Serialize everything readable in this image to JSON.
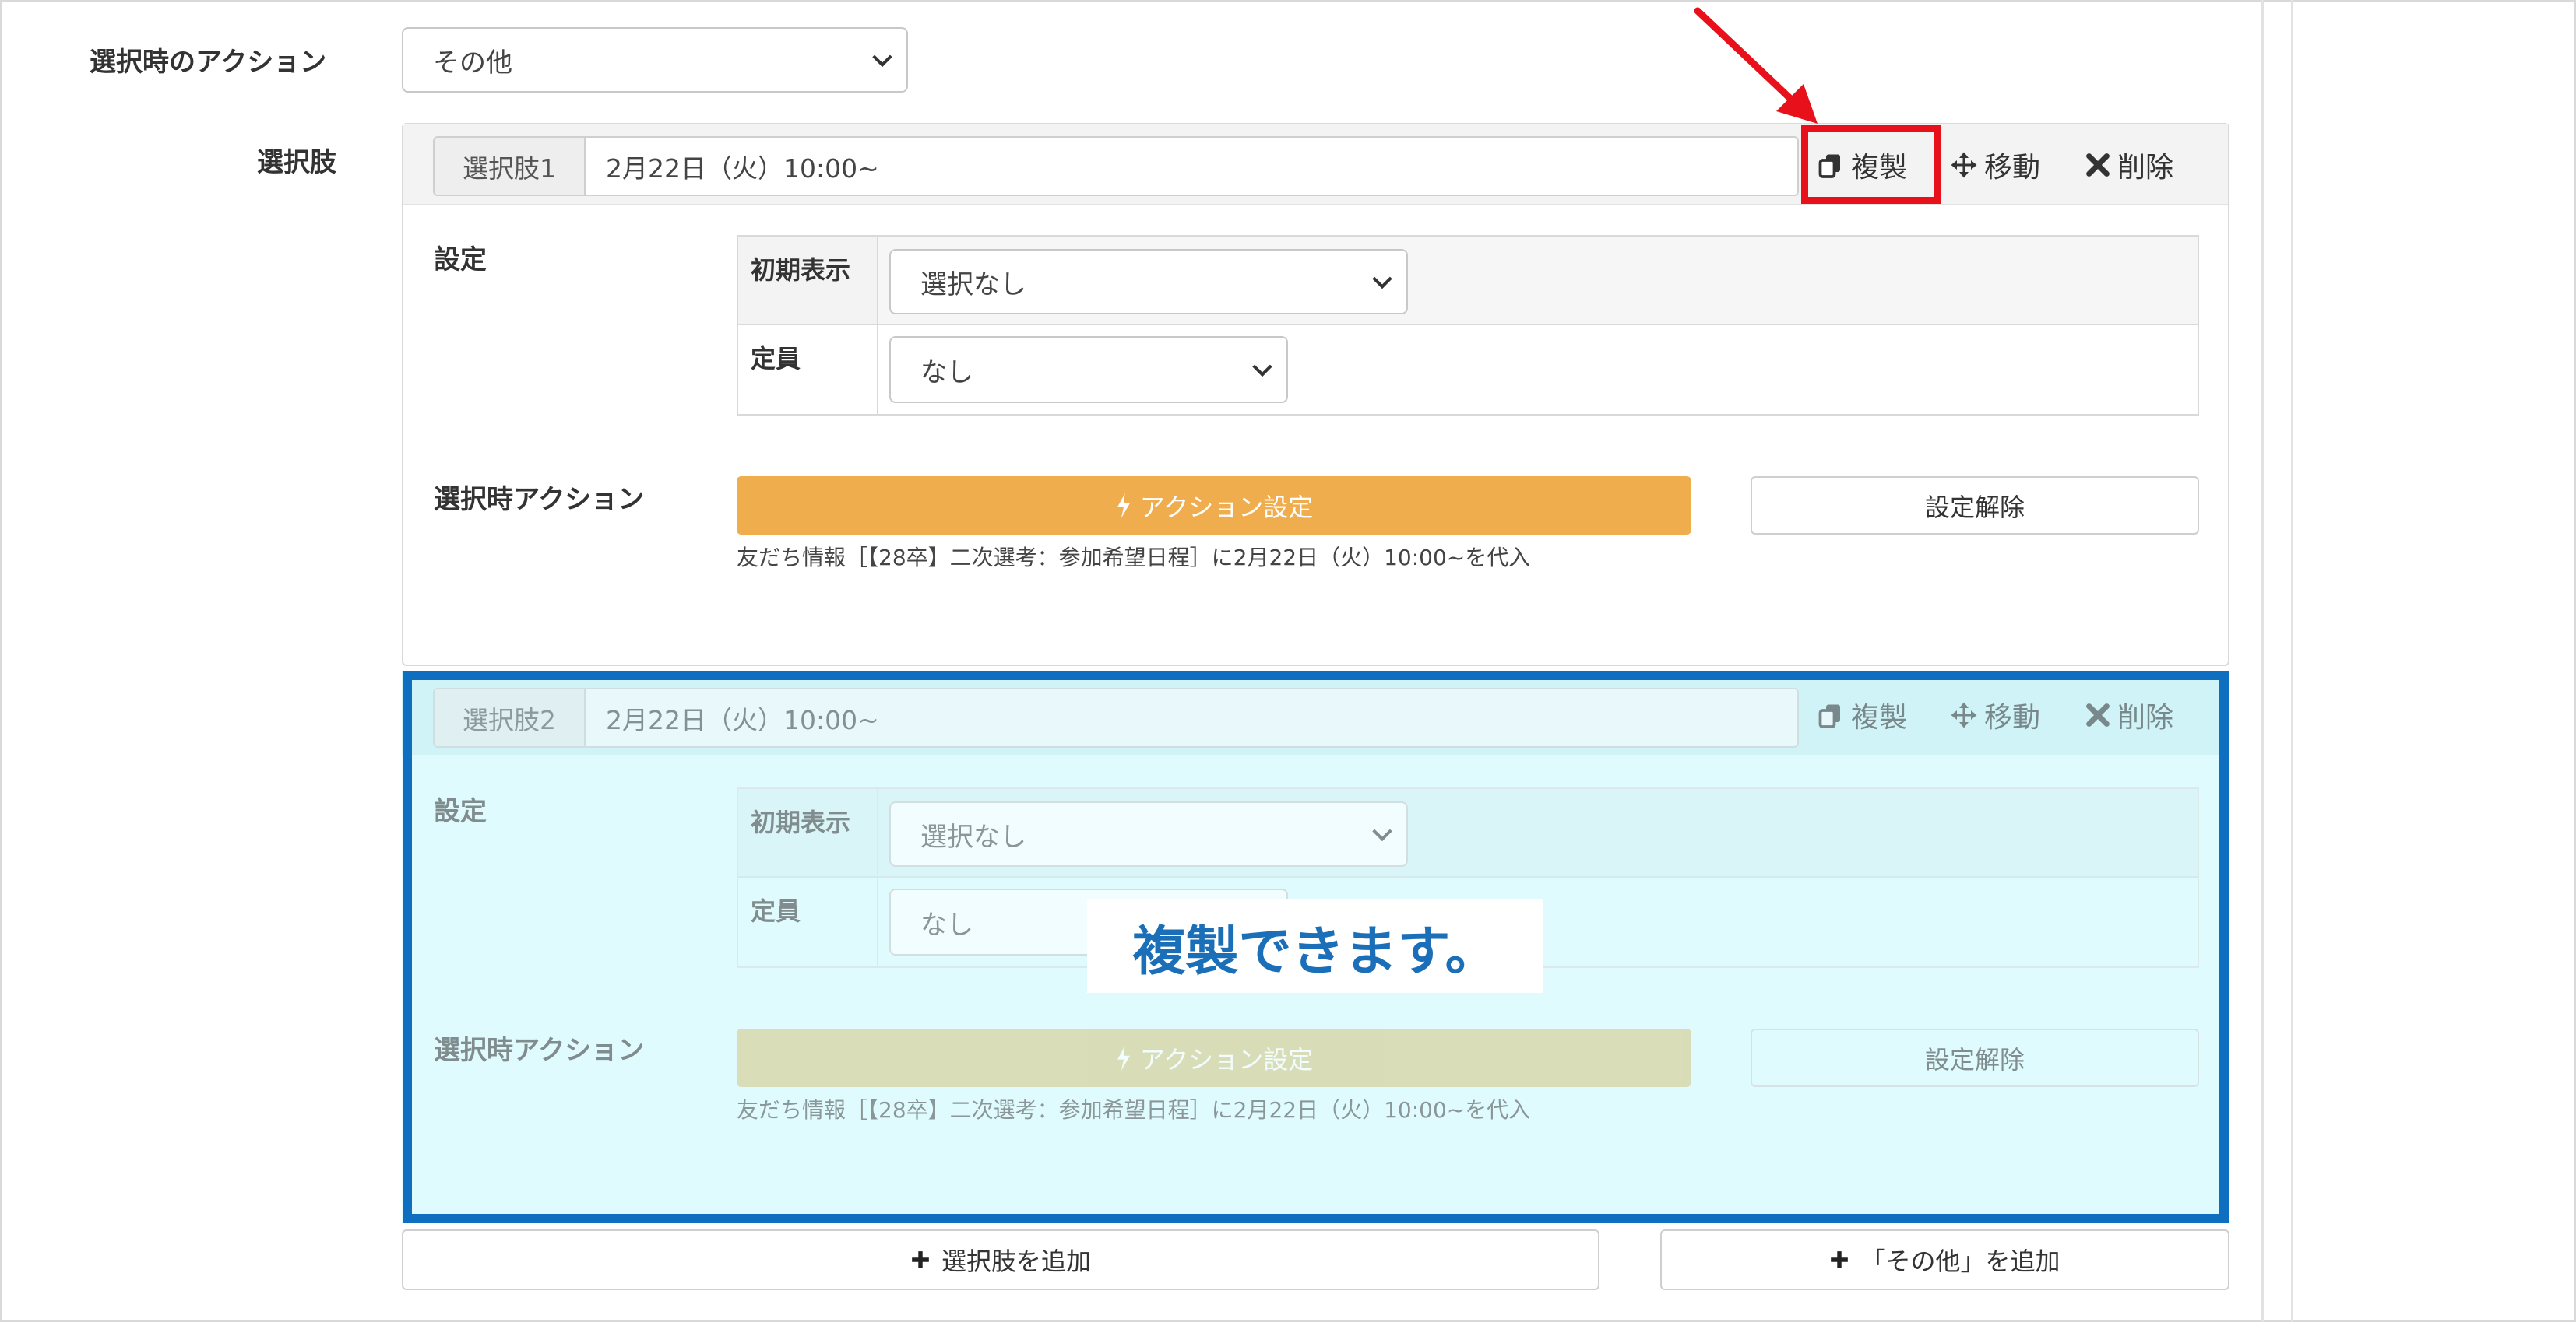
{
  "action_row": {
    "label": "選択時のアクション",
    "select_value": "その他"
  },
  "choices_label": "選択肢",
  "choices": [
    {
      "addon": "選択肢1",
      "value": "2月22日（火）10:00~",
      "tools": {
        "duplicate": "複製",
        "move": "移動",
        "delete": "削除"
      },
      "settings_label": "設定",
      "initial_display_label": "初期表示",
      "initial_display_value": "選択なし",
      "capacity_label": "定員",
      "capacity_value": "なし",
      "action_label": "選択時アクション",
      "action_button": "アクション設定",
      "clear_button": "設定解除",
      "note": "友だち情報［【28卒】二次選考：参加希望日程］に2月22日（火）10:00~を代入"
    },
    {
      "addon": "選択肢2",
      "value": "2月22日（火）10:00~",
      "tools": {
        "duplicate": "複製",
        "move": "移動",
        "delete": "削除"
      },
      "settings_label": "設定",
      "initial_display_label": "初期表示",
      "initial_display_value": "選択なし",
      "capacity_label": "定員",
      "capacity_value": "なし",
      "action_label": "選択時アクション",
      "action_button": "アクション設定",
      "clear_button": "設定解除",
      "note": "友だち情報［【28卒】二次選考：参加希望日程］に2月22日（火）10:00~を代入"
    }
  ],
  "callout": "複製できます。",
  "add_choice_button": "選択肢を追加",
  "add_other_button": "「その他」を追加",
  "colors": {
    "highlight_red": "#e8101a",
    "highlight_blue": "#0e6fc0",
    "duplicated_bg": "#e0fbfe",
    "action_orange": "#f0ad4e",
    "callout_text": "#1a6fb8"
  }
}
